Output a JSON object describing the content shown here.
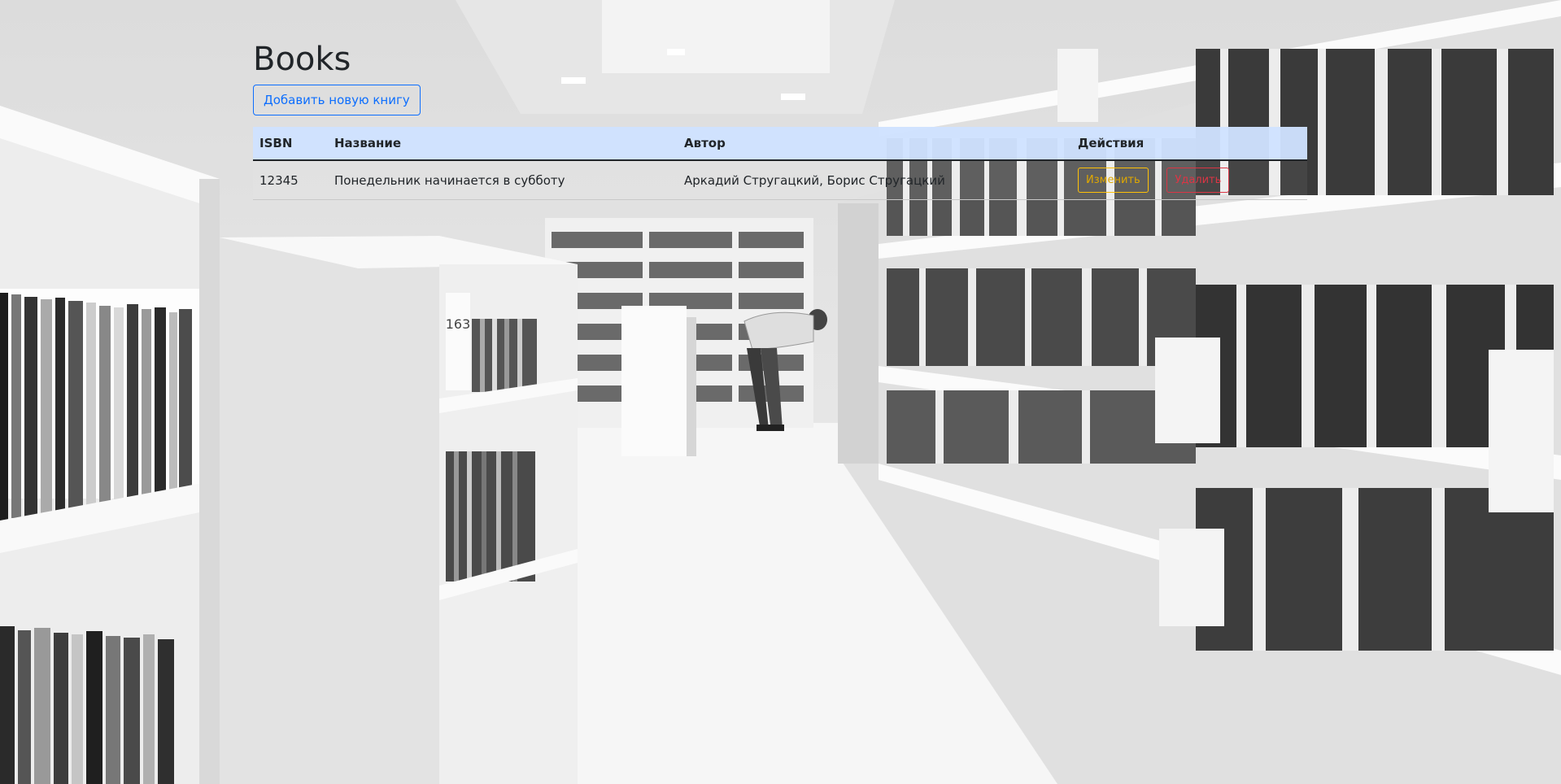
{
  "page": {
    "title": "Books",
    "add_button_label": "Добавить новую книгу"
  },
  "table": {
    "headers": {
      "isbn": "ISBN",
      "title": "Название",
      "author": "Автор",
      "actions": "Действия"
    },
    "rows": [
      {
        "isbn": "12345",
        "title": "Понедельник начинается в субботу",
        "author": "Аркадий Стругацкий, Борис Стругацкий",
        "edit_label": "Изменить",
        "delete_label": "Удалить"
      }
    ]
  },
  "background": {
    "description_icon": "library-photo",
    "shelf_number": "163"
  },
  "colors": {
    "primary": "#0d6efd",
    "warning": "#ffc107",
    "danger": "#dc3545",
    "header_bg": "#cfe2ff"
  }
}
